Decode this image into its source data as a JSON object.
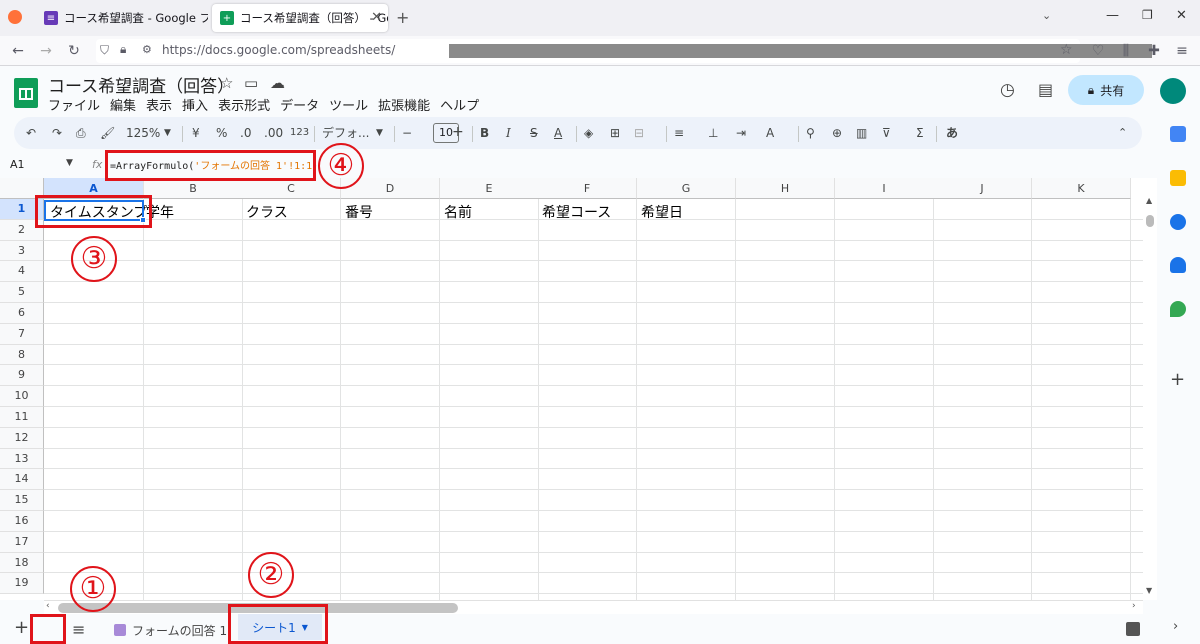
{
  "browser": {
    "tabs": [
      {
        "title": "コース希望調査 - Google フォーム",
        "icon": "google-forms-icon",
        "color": "#673ab7"
      },
      {
        "title": "コース希望調査（回答） - Googl",
        "icon": "google-sheets-icon",
        "color": "#0f9d58"
      }
    ],
    "new_tab": "+",
    "url": "https://docs.google.com/spreadsheets/"
  },
  "doc": {
    "title": "コース希望調査（回答）",
    "menu": [
      "ファイル",
      "編集",
      "表示",
      "挿入",
      "表示形式",
      "データ",
      "ツール",
      "拡張機能",
      "ヘルプ"
    ],
    "share_label": "共有"
  },
  "toolbar": {
    "zoom": "125%",
    "currency": "¥",
    "percent": "%",
    "dec_decrease": ".0",
    "dec_increase": ".00",
    "format_123": "123",
    "font": "デフォ...",
    "font_size": "10",
    "input_tool": "あ"
  },
  "formula_bar": {
    "name_box": "A1",
    "fx": "fx",
    "formula_prefix": "=ArrayFormulo(",
    "formula_string": "'フォームの回答 1'!1:1",
    "formula_suffix": ")"
  },
  "grid": {
    "columns": [
      "A",
      "B",
      "C",
      "D",
      "E",
      "F",
      "G",
      "H",
      "I",
      "J",
      "K"
    ],
    "rows": [
      "1",
      "2",
      "3",
      "4",
      "5",
      "6",
      "7",
      "8",
      "9",
      "10",
      "11",
      "12",
      "13",
      "14",
      "15",
      "16",
      "17",
      "18",
      "19"
    ],
    "row1": [
      "タイムスタンプ",
      "学年",
      "クラス",
      "番号",
      "名前",
      "希望コース",
      "希望日"
    ]
  },
  "sheet_tabs": {
    "add": "+",
    "list": "≡",
    "tabs": [
      "フォームの回答 1",
      "シート1"
    ]
  },
  "annotations": [
    "①",
    "②",
    "③",
    "④"
  ],
  "colors": {
    "annotation_red": "#e0141a",
    "selection_blue": "#1a73e8",
    "active_tab": "#0b57d0"
  }
}
